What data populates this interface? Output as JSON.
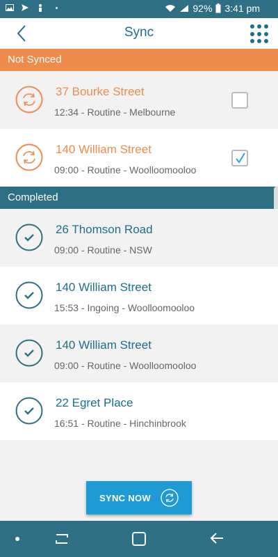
{
  "status": {
    "battery": "92%",
    "time": "3:41 pm"
  },
  "header": {
    "title": "Sync"
  },
  "sections": {
    "not_synced": "Not Synced",
    "completed": "Completed"
  },
  "not_synced_items": [
    {
      "title": "37 Bourke Street",
      "sub": "12:34 - Routine - Melbourne",
      "checked": false
    },
    {
      "title": "140 William Street",
      "sub": "09:00 - Routine - Woolloomooloo",
      "checked": true
    }
  ],
  "completed_items": [
    {
      "title": "26 Thomson Road",
      "sub": "09:00 - Routine - NSW"
    },
    {
      "title": "140 William Street",
      "sub": "15:53 - Ingoing - Woolloomooloo"
    },
    {
      "title": "140 William Street",
      "sub": "09:00 - Routine - Woolloomooloo"
    },
    {
      "title": "22 Egret Place",
      "sub": "16:51 - Routine - Hinchinbrook"
    }
  ],
  "sync_button": {
    "label": "SYNC NOW"
  },
  "colors": {
    "orange": "#ef8c4b",
    "teal": "#1c6f8c",
    "header": "#2f6f86",
    "button": "#1e9bd4"
  }
}
